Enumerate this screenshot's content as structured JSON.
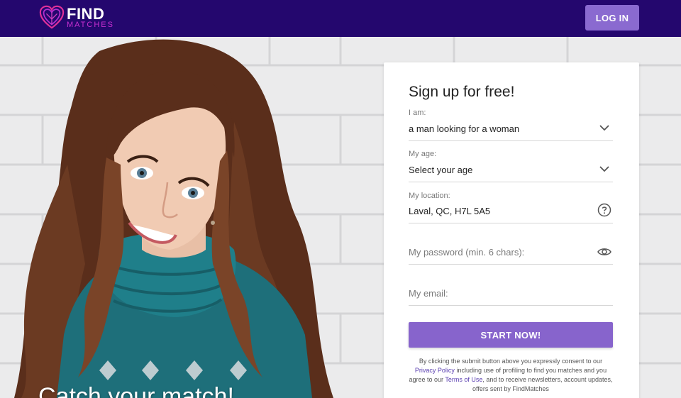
{
  "header": {
    "logo_primary": "FIND",
    "logo_secondary": "MATCHES",
    "login_label": "LOG IN"
  },
  "hero": {
    "tagline": "Catch your match!"
  },
  "form": {
    "title": "Sign up for free!",
    "iam": {
      "label": "I am:",
      "value": "a man looking for a woman"
    },
    "age": {
      "label": "My age:",
      "value": "Select your age"
    },
    "location": {
      "label": "My location:",
      "value": "Laval, QC, H7L 5A5"
    },
    "password": {
      "placeholder": "My password (min. 6 chars):"
    },
    "email": {
      "placeholder": "My email:"
    },
    "submit_label": "START NOW!",
    "disclaimer": {
      "part1": "By clicking the submit button above you expressly consent to our ",
      "privacy_link": "Privacy Policy",
      "part2": " including use of profiling to find you matches and you agree to our ",
      "terms_link": "Terms of Use",
      "part3": ", and to receive newsletters, account updates, offers sent by FindMatches"
    }
  },
  "colors": {
    "header_bg": "#24076e",
    "accent": "#8764cc",
    "logo_pink": "#c72fd0"
  },
  "icons": [
    "heart-logo-icon",
    "chevron-down-icon",
    "help-circle-icon",
    "eye-icon"
  ]
}
